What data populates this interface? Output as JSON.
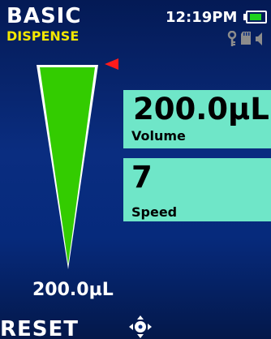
{
  "header": {
    "title": "BASIC",
    "mode": "DISPENSE",
    "time": "12:19PM",
    "battery_level": 0.85,
    "status_icons": [
      "key-icon",
      "sd-card-icon",
      "speaker-icon"
    ]
  },
  "volume": {
    "value": "200.0µL",
    "label": "Volume"
  },
  "speed": {
    "value": "7",
    "label": "Speed"
  },
  "gauge": {
    "label": "200.0µL",
    "fill_fraction": 1.0,
    "indicator": "red-triangle-pointer"
  },
  "footer": {
    "left_label": "RESET",
    "center_icon": "joystick-icon"
  },
  "colors": {
    "background": "#0a2d80",
    "gauge_fill": "#33cc00",
    "card": "#6fe6c8",
    "mode_text": "#f2e600",
    "pointer": "#ff1a1a"
  }
}
